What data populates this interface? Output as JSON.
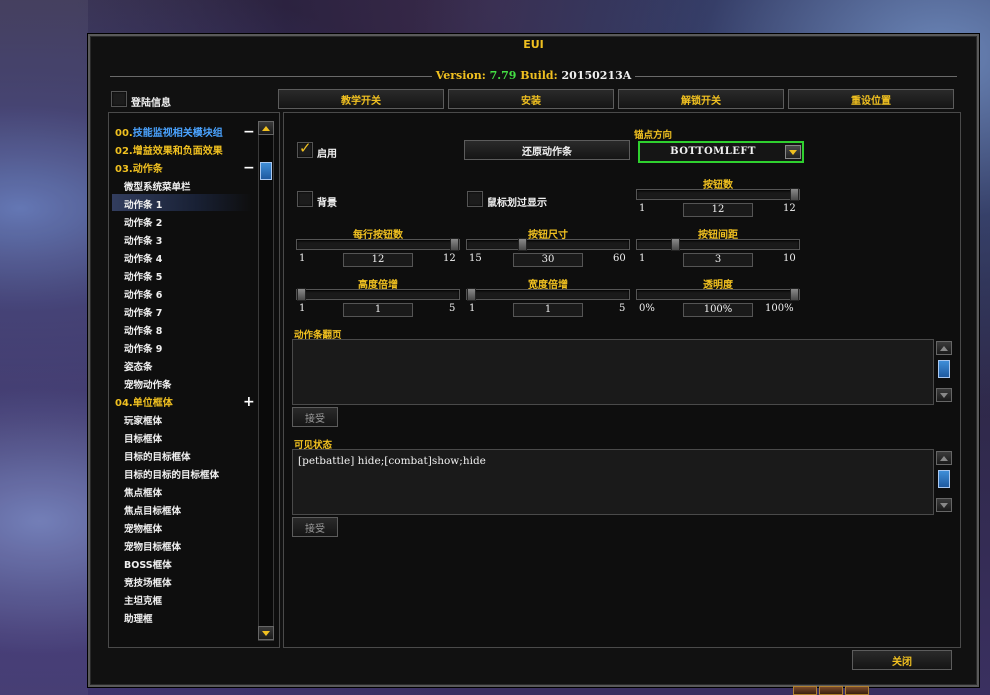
{
  "window": {
    "title": "EUI",
    "version_label": "Version:",
    "version_value": "7.79",
    "build_label": "Build:",
    "build_value": "20150213A"
  },
  "top": {
    "login_info": {
      "label": "登陆信息",
      "checked": false
    },
    "buttons": [
      "教学开关",
      "安装",
      "解锁开关",
      "重设位置"
    ]
  },
  "nav": {
    "categories": [
      {
        "prefix": "00.",
        "label": "技能监视相关模块组",
        "toggle": "−"
      },
      {
        "prefix": "02.",
        "label": "增益效果和负面效果",
        "toggle": ""
      },
      {
        "prefix": "03.",
        "label": "动作条",
        "toggle": "−"
      },
      {
        "prefix": "04.",
        "label": "单位框体",
        "toggle": "+"
      }
    ],
    "items_actionbars": [
      "微型系统菜单栏",
      "动作条 1",
      "动作条 2",
      "动作条 3",
      "动作条 4",
      "动作条 5",
      "动作条 6",
      "动作条 7",
      "动作条 8",
      "动作条 9",
      "姿态条",
      "宠物动作条"
    ],
    "items_unitframes": [
      "玩家框体",
      "目标框体",
      "目标的目标框体",
      "目标的目标的目标框体",
      "焦点框体",
      "焦点目标框体",
      "宠物框体",
      "宠物目标框体",
      "BOSS框体",
      "竞技场框体",
      "主坦克框",
      "助理框"
    ],
    "selected": "动作条 1"
  },
  "settings": {
    "enable": {
      "label": "启用",
      "checked": true
    },
    "restore_button": "还原动作条",
    "anchor": {
      "label": "锚点方向",
      "value": "BOTTOMLEFT"
    },
    "background": {
      "label": "背景",
      "checked": false
    },
    "mouseover": {
      "label": "鼠标划过显示",
      "checked": false
    },
    "sliders": {
      "buttons_count": {
        "title": "按钮数",
        "min": "1",
        "max": "12",
        "value": "12",
        "fraction": 1.0
      },
      "per_row": {
        "title": "每行按钮数",
        "min": "1",
        "max": "12",
        "value": "12",
        "fraction": 1.0
      },
      "button_size": {
        "title": "按钮尺寸",
        "min": "15",
        "max": "60",
        "value": "30",
        "fraction": 0.333
      },
      "button_spacing": {
        "title": "按钮间距",
        "min": "1",
        "max": "10",
        "value": "3",
        "fraction": 0.222
      },
      "height_mult": {
        "title": "高度倍增",
        "min": "1",
        "max": "5",
        "value": "1",
        "fraction": 0.0
      },
      "width_mult": {
        "title": "宽度倍增",
        "min": "1",
        "max": "5",
        "value": "1",
        "fraction": 0.0
      },
      "alpha": {
        "title": "透明度",
        "min": "0%",
        "max": "100%",
        "value": "100%",
        "fraction": 1.0
      }
    },
    "paging": {
      "label": "动作条翻页",
      "text": "",
      "accept_button": "接受"
    },
    "visibility": {
      "label": "可见状态",
      "text": "[petbattle] hide;[combat]show;hide",
      "accept_button": "接受"
    }
  },
  "footer": {
    "close_button": "关闭"
  }
}
